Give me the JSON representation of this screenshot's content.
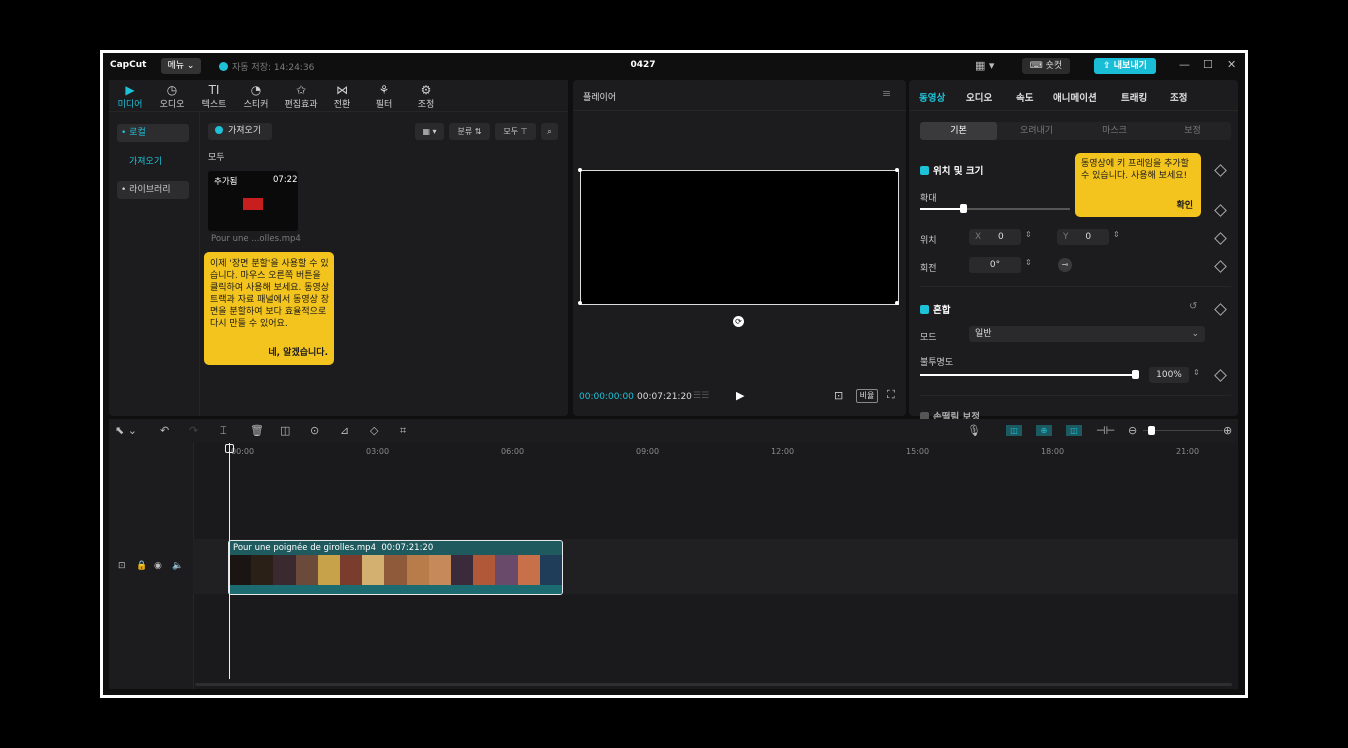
{
  "titlebar": {
    "logo": "CapCut",
    "menu_label": "메뉴 ⌄",
    "autosave": "자동 저장: 14:24:36",
    "project_title": "0427",
    "shortcut_label": "⌨ 숏컷",
    "export_label": "⇪ 내보내기"
  },
  "media_panel": {
    "tabs": [
      {
        "label": "미디어",
        "icon": "▶"
      },
      {
        "label": "오디오",
        "icon": "◷"
      },
      {
        "label": "텍스트",
        "icon": "TI"
      },
      {
        "label": "스티커",
        "icon": "◔"
      },
      {
        "label": "편집효과",
        "icon": "✩"
      },
      {
        "label": "전환",
        "icon": "⋈"
      },
      {
        "label": "필터",
        "icon": "⚘"
      },
      {
        "label": "조정",
        "icon": "⚙"
      }
    ],
    "sidebar": [
      {
        "label": "• 로컬"
      },
      {
        "label": "가져오기"
      },
      {
        "label": "• 라이브러리"
      }
    ],
    "import_label": "가져오기",
    "sort_label": "분류 ⇅",
    "filter_label": "모두 ⊤",
    "section_label": "모두",
    "media_item": {
      "badge": "추가됨",
      "duration": "07:22",
      "filename": "Pour une ...olles.mp4"
    },
    "tooltip": {
      "text": "이제 '장면 분할'을 사용할 수 있습니다. 마우스 오른쪽 버튼을 클릭하여 사용해 보세요. 동영상 트랙과 자료 패널에서 동영상 장면을 분할하여 보다 효율적으로 다시 만들 수 있어요.",
      "confirm": "네, 알겠습니다."
    }
  },
  "player": {
    "title": "플레이어",
    "current_time": "00:00:00:00",
    "total_time": "00:07:21:20",
    "ratio_label": "비율"
  },
  "properties": {
    "tabs": [
      "동영상",
      "오디오",
      "속도",
      "애니메이션",
      "트래킹",
      "조정"
    ],
    "subtabs": [
      "기본",
      "오려내기",
      "마스크",
      "보정"
    ],
    "transform": {
      "title": "위치 및 크기",
      "scale_label": "확대",
      "position_label": "위치",
      "x_label": "X",
      "x_value": "0",
      "y_label": "Y",
      "y_value": "0",
      "rotation_label": "회전",
      "rotation_value": "0°",
      "scale_level": 0.35
    },
    "blend": {
      "title": "혼합",
      "mode_label": "모드",
      "mode_value": "일반",
      "opacity_label": "불투명도",
      "opacity_value": "100%",
      "opacity_level": 1.0
    },
    "next_section": "손떨림 보정",
    "tooltip": {
      "text": "동영상에 키 프레임을 추가할 수 있습니다. 사용해 보세요!",
      "confirm": "확인"
    }
  },
  "timeline": {
    "ruler": [
      "00:00",
      "03:00",
      "06:00",
      "09:00",
      "12:00",
      "15:00",
      "18:00",
      "21:00"
    ],
    "clip": {
      "title": "Pour une poignée de girolles.mp4",
      "duration": "00:07:21:20"
    },
    "frame_colors": [
      "#1a1412",
      "#2b2018",
      "#3a2a30",
      "#6b4a3c",
      "#c8a24a",
      "#7a3c2c",
      "#d4b070",
      "#8e5a3a",
      "#b87b4a",
      "#c68a5a",
      "#3a2a3a",
      "#b05838",
      "#6a4a6a",
      "#c7704a",
      "#1f3c58"
    ]
  },
  "colors": {
    "accent": "#1ec2d8",
    "tooltip": "#f4c41e",
    "clip_bg": "#1f5a5f"
  }
}
